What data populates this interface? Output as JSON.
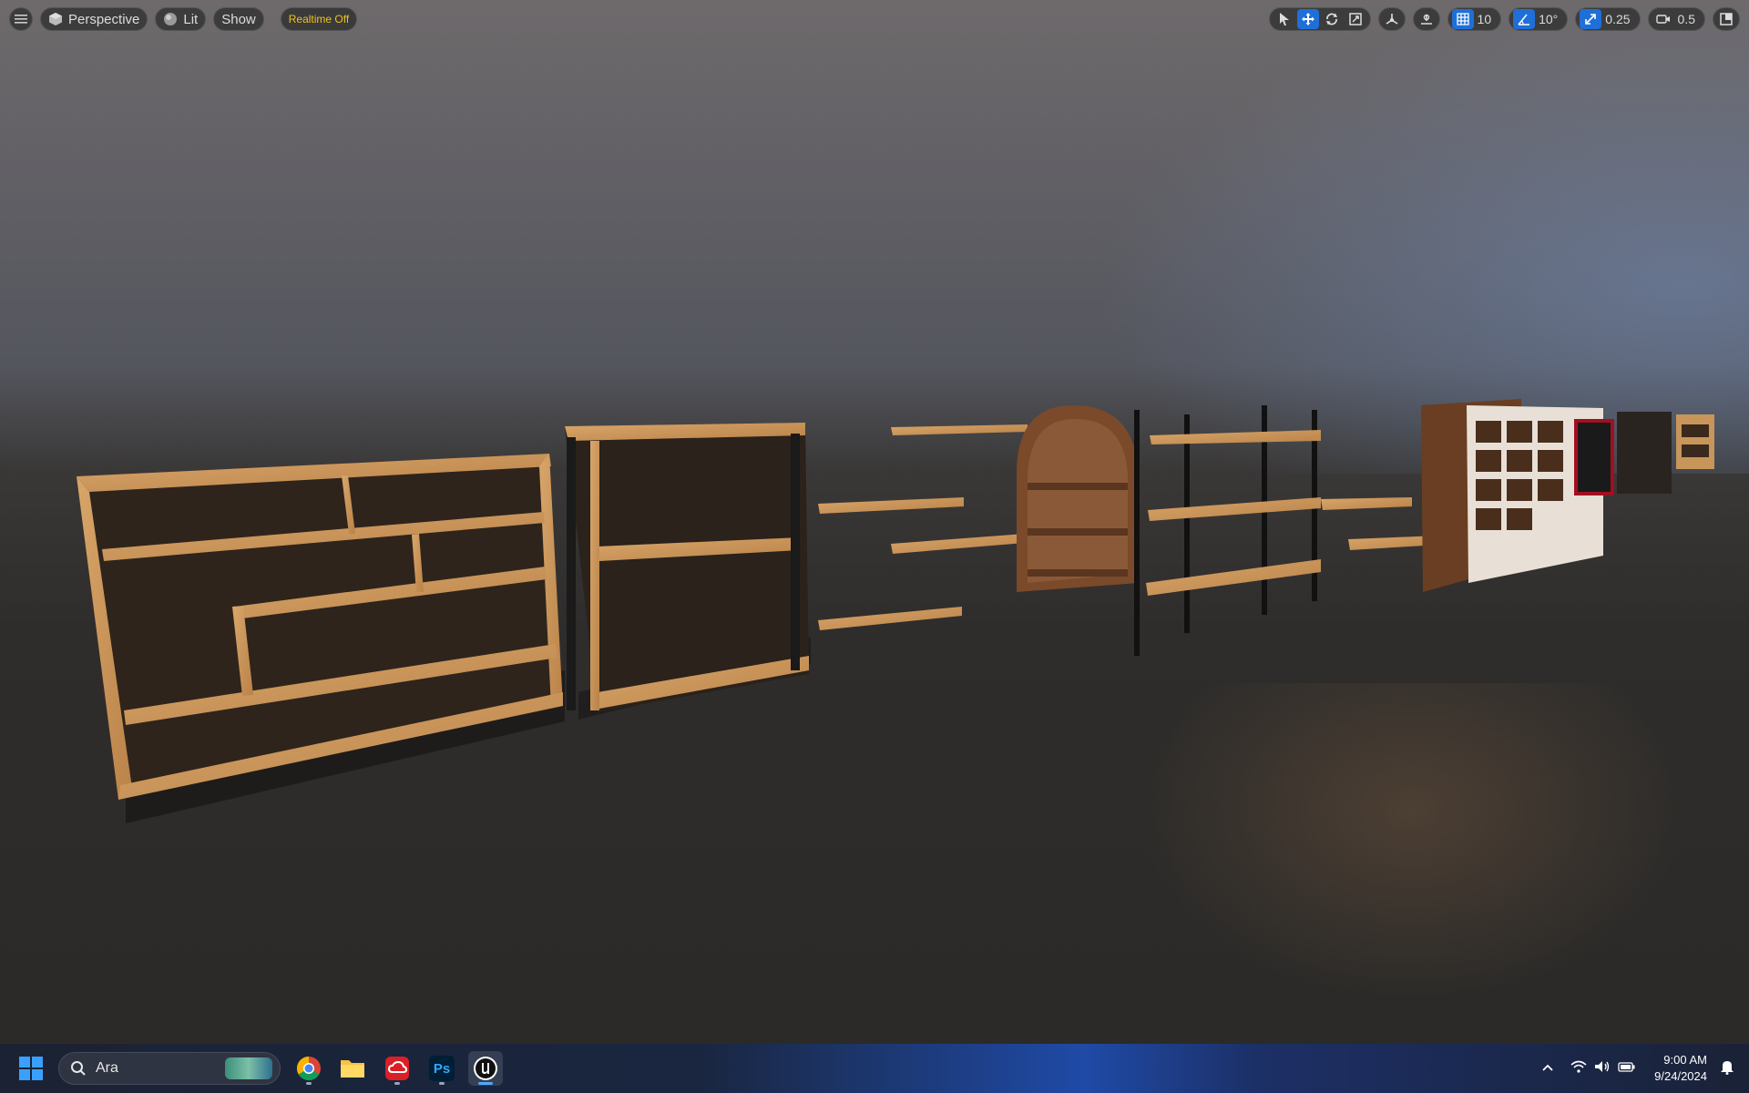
{
  "viewport": {
    "toolbar_left": {
      "menu_icon": "hamburger-icon",
      "perspective_label": "Perspective",
      "lit_label": "Lit",
      "show_label": "Show",
      "realtime_label": "Realtime Off"
    },
    "toolbar_right": {
      "select_icon": "cursor-icon",
      "translate_icon": "move-icon",
      "rotate_icon": "rotate-icon",
      "scale_icon": "scale-icon",
      "grid_snap_value": "10",
      "rotation_snap_value": "10°",
      "scale_snap_value": "0.25",
      "camera_speed_value": "0.5"
    }
  },
  "taskbar": {
    "search_text": "Ara",
    "apps": [
      "chrome-icon",
      "file-explorer-icon",
      "creative-cloud-icon",
      "photoshop-icon",
      "unreal-engine-icon"
    ],
    "photoshop_label": "Ps",
    "time": "9:00 AM",
    "date": "9/24/2024"
  },
  "colors": {
    "accent": "#1f6fd8",
    "realtime_text": "#f0c020",
    "wood": "#c8955a"
  }
}
